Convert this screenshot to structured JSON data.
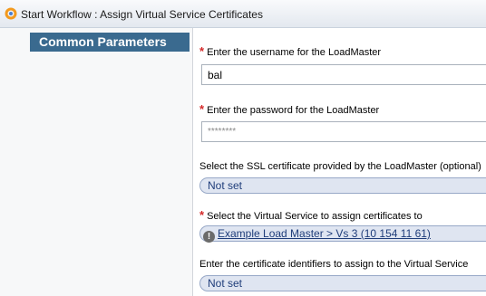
{
  "window": {
    "title": "Start Workflow : Assign Virtual Service Certificates",
    "icon": "workflow-ring-icon"
  },
  "sidebar": {
    "items": [
      {
        "label": "Common Parameters",
        "selected": true
      }
    ]
  },
  "form": {
    "username": {
      "label": "Enter the username for the LoadMaster",
      "required": true,
      "value": "bal"
    },
    "password": {
      "label": "Enter the password for the LoadMaster",
      "required": true,
      "value": "********"
    },
    "ssl_certificate": {
      "label": "Select the SSL certificate provided by the LoadMaster (optional)",
      "required": false,
      "value": "Not set"
    },
    "virtual_service": {
      "label": "Select the Virtual Service to assign certificates to",
      "required": true,
      "value": "Example Load Master > Vs 3 (10 154 11 61)",
      "icon": "info-icon"
    },
    "cert_identifiers": {
      "label": "Enter the certificate identifiers to assign to the Virtual Service",
      "required": false,
      "value": "Not set"
    }
  },
  "colors": {
    "required_star": "#d42a2a",
    "sidebar_selected": "#3a6a8f",
    "selector_bg": "#dfe5f1",
    "link": "#1f3d7a"
  }
}
